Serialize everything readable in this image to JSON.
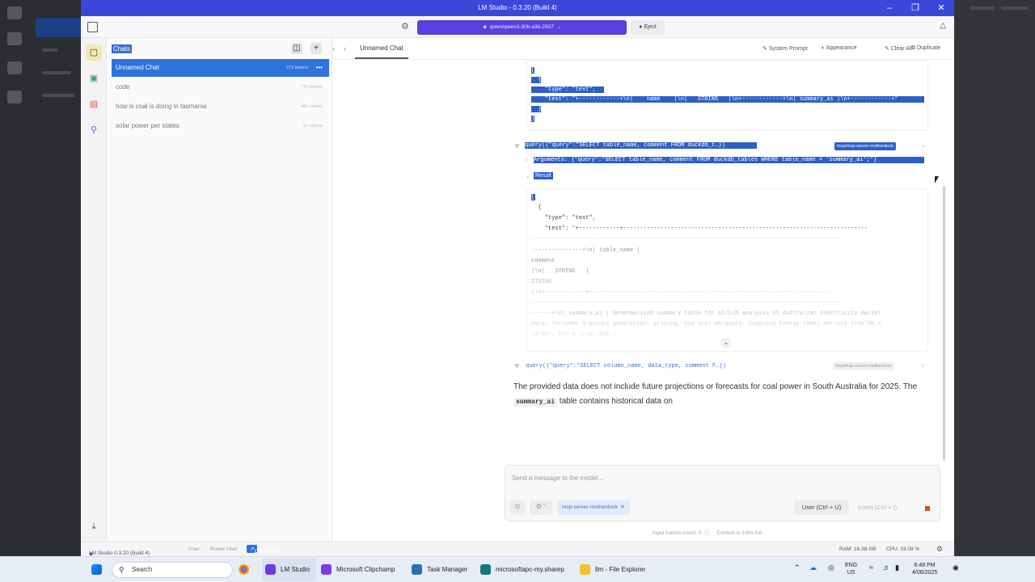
{
  "window": {
    "title": "LM Studio - 0.3.20 (Build 4)",
    "model": "qwen/qwen3-30b-a3b-2507",
    "eject_label": "Eject"
  },
  "sidebar": {
    "header": "Chats",
    "items": [
      {
        "label": "Unnamed Chat",
        "tokens": "272 tokens",
        "selected": true
      },
      {
        "label": "code",
        "tokens": "770 tokens"
      },
      {
        "label": "how is coal is doing in tasmania",
        "tokens": "441 tokens"
      },
      {
        "label": "solar power per states",
        "tokens": "91 tokens"
      }
    ]
  },
  "tab": {
    "label": "Unnamed Chat"
  },
  "actions": {
    "system_prompt": "System Prompt",
    "appearance": "Appearance",
    "clear_all": "Clear All",
    "duplicate": "Duplicate"
  },
  "tool_result_1": {
    "lines": [
      "[",
      "  {",
      "    \"type\": \"text\",",
      "    \"text\": \"+------------+\\n|    name    |\\n|   STRING   |\\n+------------+\\n| summary_ai |\\n+------------+\"",
      "  }",
      "]"
    ]
  },
  "tool_call_1": {
    "call": "query({\"query\":\"SELECT table_name, comment FROM duckdb_t…})",
    "server": "mcp/mcp-server-motherduck",
    "arguments": "Arguments: {\"query\":\"SELECT table_name, comment FROM duckdb_tables WHERE table_name = 'summary_ai';\"}",
    "result_label": "Result"
  },
  "tool_result_2": {
    "lines": [
      "[",
      "  {",
      "    \"type\": \"text\",",
      "    \"text\": \"+------------+------------------------------------------------------------------------",
      "--------------------------------------------------------------------------------------------",
      "---------------+\\n| table_name |",
      "comment",
      "|\\n|   STRING   |",
      "STRING",
      "|\\n+------------+-----------------------------------------------------------------------",
      "--------------------------------------------------------------------------------------------",
      "------+\\n| summary_ai | Denormalized summary table for AI/LLM analysis of Australian electricity market",
      "data. Includes 5-minute generation, pricing, and unit metadata. Computed Energy (MWh) derived from MW x",
      "(5/60). Ren % (via. Ene..."
    ]
  },
  "tool_call_2": {
    "call": "query({\"query\":\"SELECT column_name, data_type, comment F…})",
    "server": "mcp/mcp-server-motherduck"
  },
  "answer": {
    "part1": "The provided data does not include future projections or forecasts for coal power in South Australia for 2025. The",
    "code": "summary_ai",
    "part2": "table contains historical data on"
  },
  "composer": {
    "placeholder": "Send a message to the model...",
    "chip": "mcp-server-motherduck",
    "user": "User (Ctrl + U)",
    "insert": "Insert (Ctrl + I)"
  },
  "meta": {
    "input_tokens": "Input tokens count:  0",
    "context": "Context is 3.6% full"
  },
  "statusbar": {
    "app": "LM Studio 0.3.20 (Build 4)",
    "modes": [
      "User",
      "Power User",
      "Developer"
    ],
    "ram": "RAM: 16.38 GB",
    "cpu": "CPU: 33.08 %"
  },
  "taskbar": {
    "search": "Search",
    "apps": [
      "LM Studio",
      "Microsoft Clipchamp",
      "Task Manager",
      "microsoftapc-my.sharep",
      "llm - File Explorer"
    ],
    "lang1": "ENG",
    "lang2": "US",
    "time": "6:49 PM",
    "date": "4/08/2025"
  },
  "colors": {
    "accent": "#2f73db",
    "model_selector": "#5b3ee0",
    "titlebar": "#3b47d9",
    "selection": "#2e5fc9"
  }
}
